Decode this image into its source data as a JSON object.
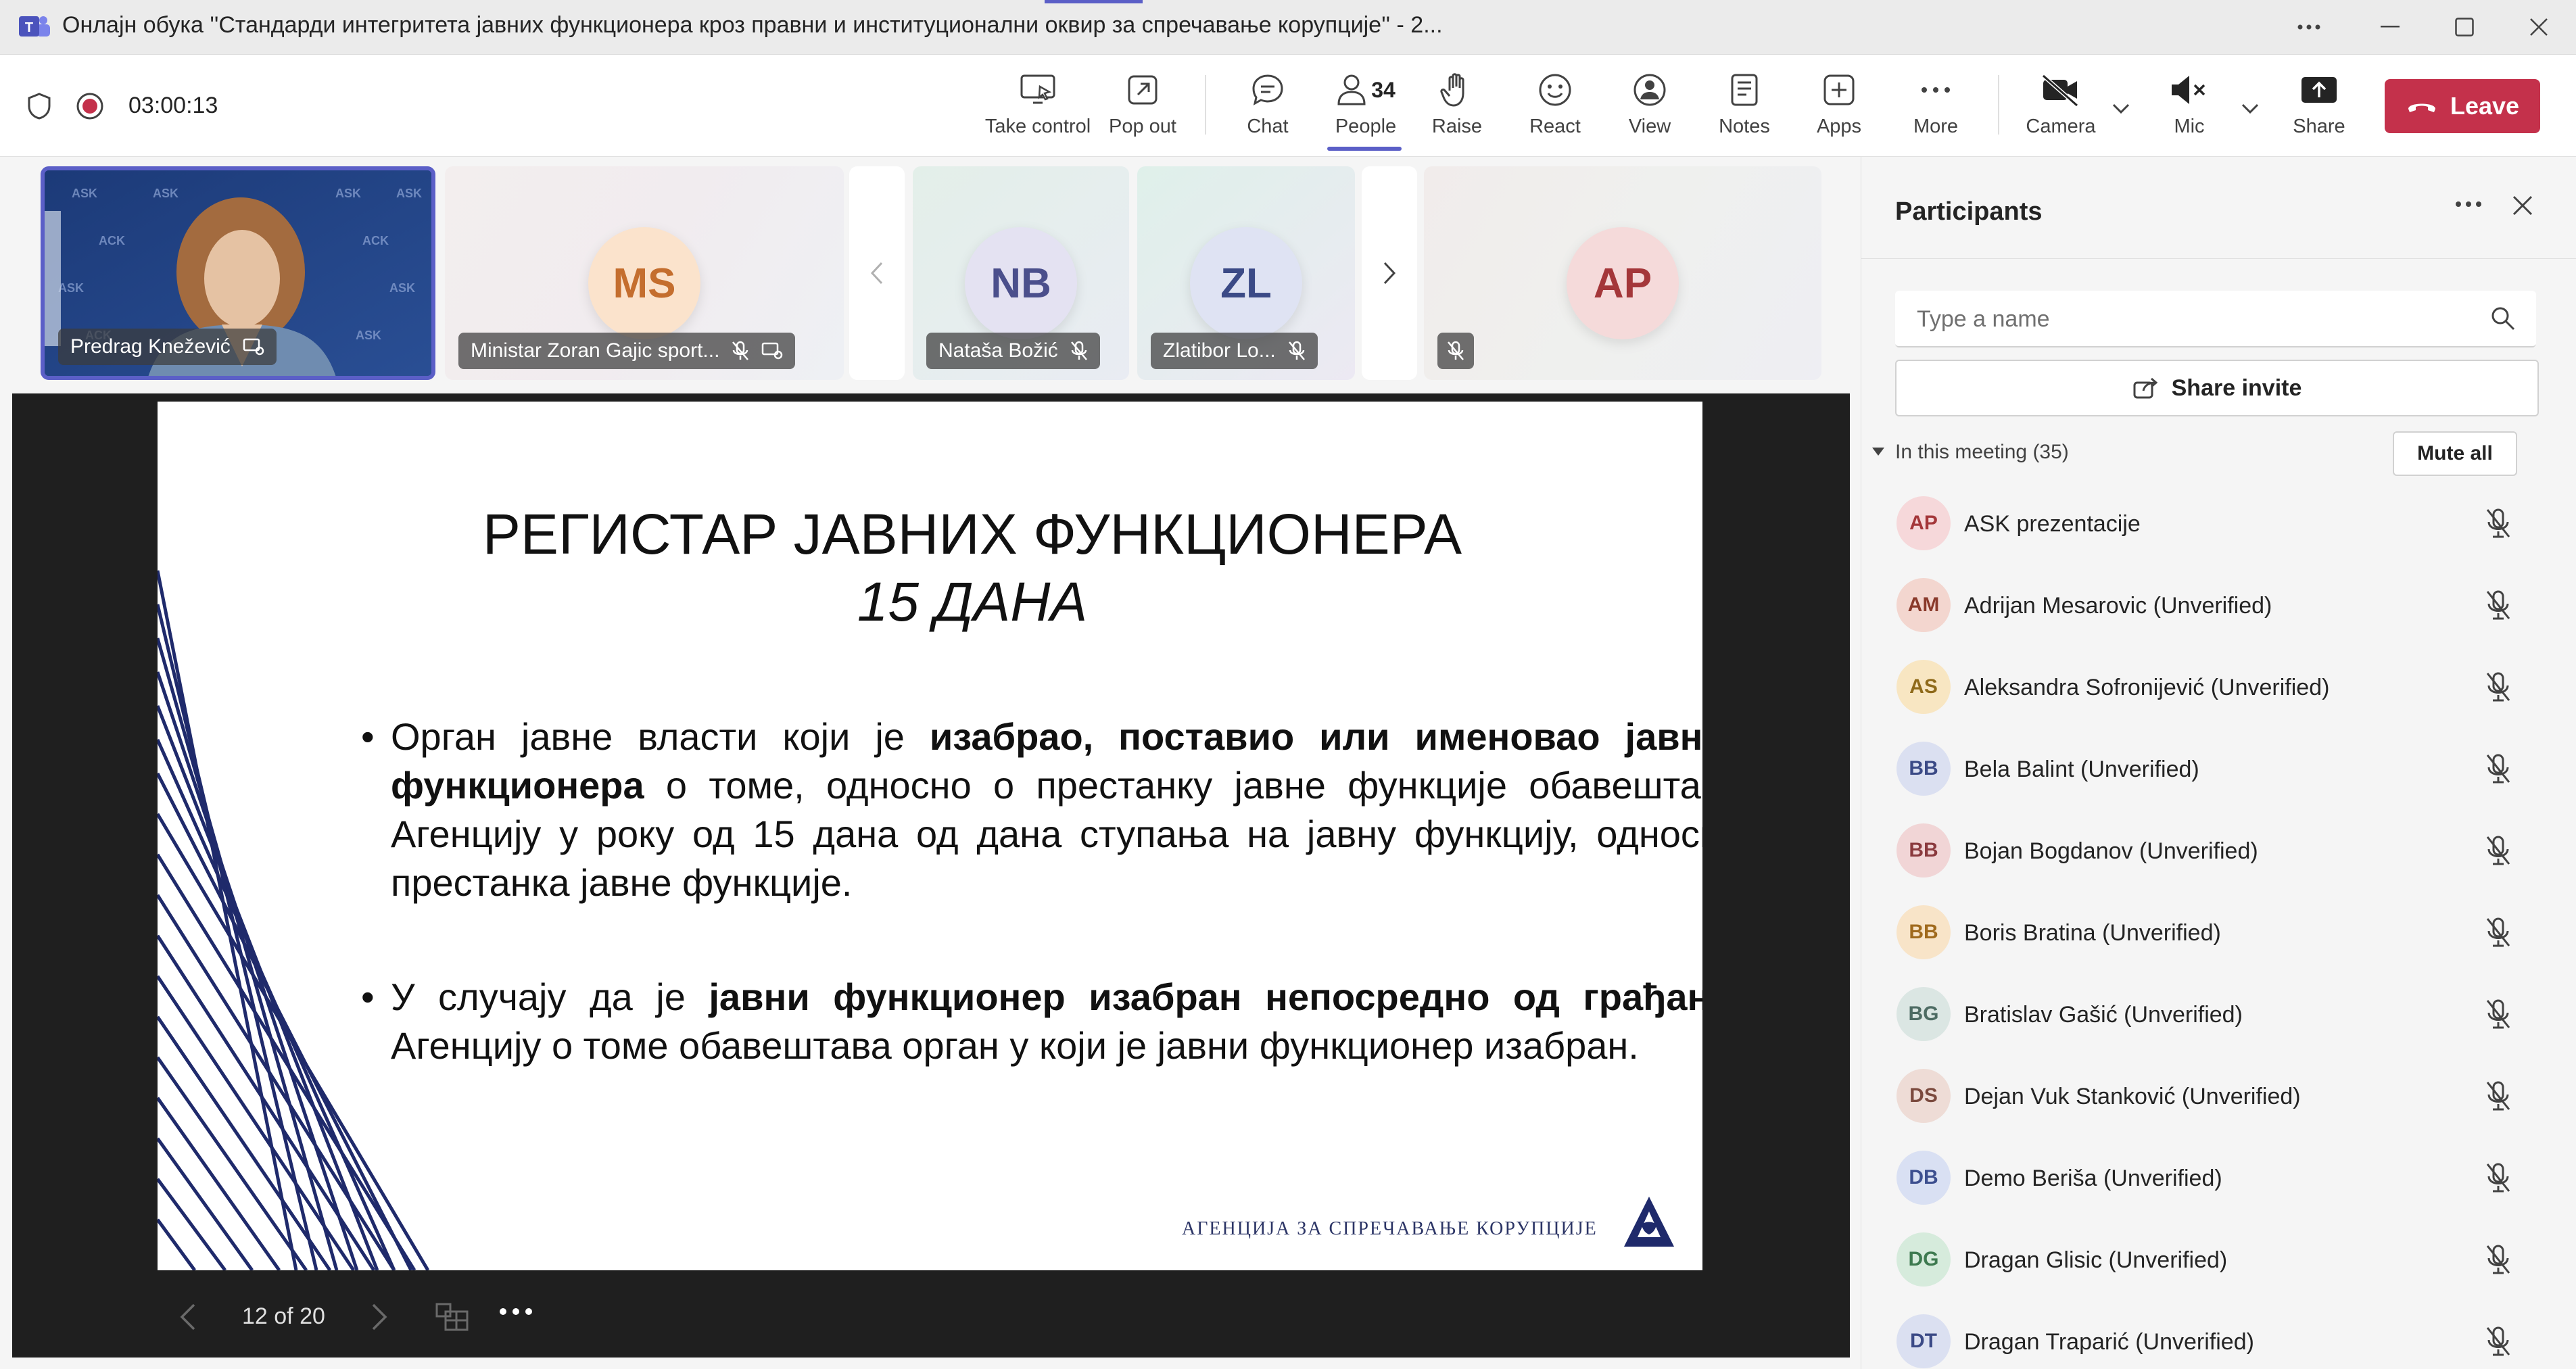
{
  "window": {
    "title": "Онлајн обука ''Стандарди интегритета јавних функционера кроз правни и институционални оквир за спречавање корупције'' - 2..."
  },
  "toolbar": {
    "timer": "03:00:13",
    "take_control": "Take control",
    "pop_out": "Pop out",
    "chat": "Chat",
    "people": "People",
    "people_count": "34",
    "raise": "Raise",
    "react": "React",
    "view": "View",
    "notes": "Notes",
    "apps": "Apps",
    "more": "More",
    "camera": "Camera",
    "mic": "Mic",
    "share": "Share",
    "leave": "Leave"
  },
  "video_tiles": [
    {
      "name": "Predrag Knežević",
      "initials": ""
    },
    {
      "name": "Ministar Zoran Gajic sport...",
      "initials": "MS",
      "color": "#c46e2e",
      "bg": "#fbe3cc"
    },
    {
      "name": "Nataša Božić",
      "initials": "NB",
      "color": "#4b4f8c",
      "bg": "#e4e2f2"
    },
    {
      "name": "Zlatibor Lo...",
      "initials": "ZL",
      "color": "#3b4a86",
      "bg": "#dfe3f3"
    },
    {
      "name": "",
      "initials": "AP",
      "color": "#a4373a",
      "bg": "#f5dada"
    }
  ],
  "slide": {
    "title": "РЕГИСТАР ЈАВНИХ ФУНКЦИОНЕРА",
    "subtitle": "15 ДАНА",
    "bullet1_pre": "Орган јавне власти који је ",
    "bullet1_bold": "изабрао, поставио или именовао јавног функционера",
    "bullet1_post": " о томе, односно о престанку јавне функције обавештава Агенцију у року од 15 дана од дана ступања на јавну функцију, односно престанка јавне функције.",
    "bullet2_pre": "У случају да је ",
    "bullet2_bold": "јавни функционер изабран непосредно од грађана",
    "bullet2_post": ", Агенцију о томе обавештава орган у који је јавни функционер изабран.",
    "footer": "АГЕНЦИЈА ЗА СПРЕЧАВАЊЕ КОРУПЦИЈЕ",
    "counter": "12 of 20"
  },
  "participants": {
    "title": "Participants",
    "search_placeholder": "Type a name",
    "share_invite": "Share invite",
    "section": "In this meeting (35)",
    "mute_all": "Mute all",
    "list": [
      {
        "initials": "AP",
        "name": "ASK prezentacije",
        "color": "#a4373a",
        "bg": "#f6d8da"
      },
      {
        "initials": "AM",
        "name": "Adrijan Mesarovic (Unverified)",
        "color": "#8a3a2b",
        "bg": "#f3d6cf"
      },
      {
        "initials": "AS",
        "name": "Aleksandra Sofronijević (Unverified)",
        "color": "#8f6a1a",
        "bg": "#f8e6c2"
      },
      {
        "initials": "BB",
        "name": "Bela Balint (Unverified)",
        "color": "#3b4a86",
        "bg": "#dbe0f1"
      },
      {
        "initials": "BB",
        "name": "Bojan Bogdanov (Unverified)",
        "color": "#8a3a3e",
        "bg": "#f1d5d6"
      },
      {
        "initials": "BB",
        "name": "Boris Bratina (Unverified)",
        "color": "#a06a1d",
        "bg": "#f8e4c8"
      },
      {
        "initials": "BG",
        "name": "Bratislav Gašić (Unverified)",
        "color": "#4d6b63",
        "bg": "#dbe6e3"
      },
      {
        "initials": "DS",
        "name": "Dejan Vuk Stanković (Unverified)",
        "color": "#7b4a3e",
        "bg": "#eedcd6"
      },
      {
        "initials": "DB",
        "name": "Demo Beriša (Unverified)",
        "color": "#3d4f8f",
        "bg": "#d9e0f3"
      },
      {
        "initials": "DG",
        "name": "Dragan Glisic (Unverified)",
        "color": "#3e7a50",
        "bg": "#d6ebdc"
      },
      {
        "initials": "DT",
        "name": "Dragan Traparić (Unverified)",
        "color": "#3b4a86",
        "bg": "#dbe0f1"
      }
    ]
  }
}
